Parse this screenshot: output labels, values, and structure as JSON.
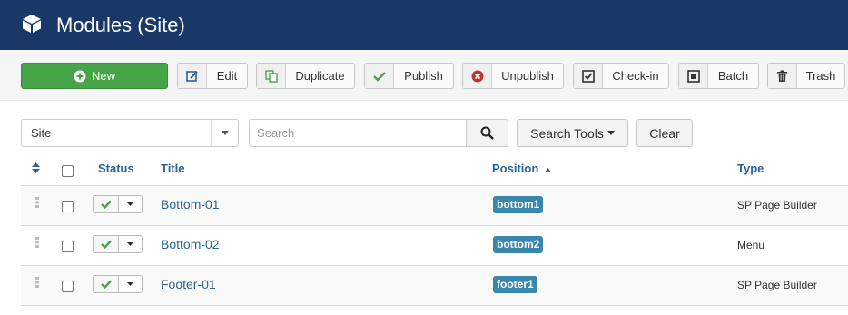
{
  "header": {
    "title": "Modules (Site)",
    "icon": "cube-icon"
  },
  "toolbar": {
    "new_label": "New",
    "edit_label": "Edit",
    "duplicate_label": "Duplicate",
    "publish_label": "Publish",
    "unpublish_label": "Unpublish",
    "checkin_label": "Check-in",
    "batch_label": "Batch",
    "trash_label": "Trash"
  },
  "filters": {
    "client_value": "Site",
    "search_placeholder": "Search",
    "search_tools_label": "Search Tools",
    "clear_label": "Clear"
  },
  "table": {
    "headers": {
      "status": "Status",
      "title": "Title",
      "position": "Position",
      "type": "Type"
    },
    "rows": [
      {
        "title": "Bottom-01",
        "position": "bottom1",
        "type": "SP Page Builder"
      },
      {
        "title": "Bottom-02",
        "position": "bottom2",
        "type": "Menu"
      },
      {
        "title": "Footer-01",
        "position": "footer1",
        "type": "SP Page Builder"
      }
    ]
  },
  "colors": {
    "header_bg": "#1a3867",
    "new_button": "#46a546",
    "badge": "#3a87ad",
    "link": "#2a6496"
  }
}
